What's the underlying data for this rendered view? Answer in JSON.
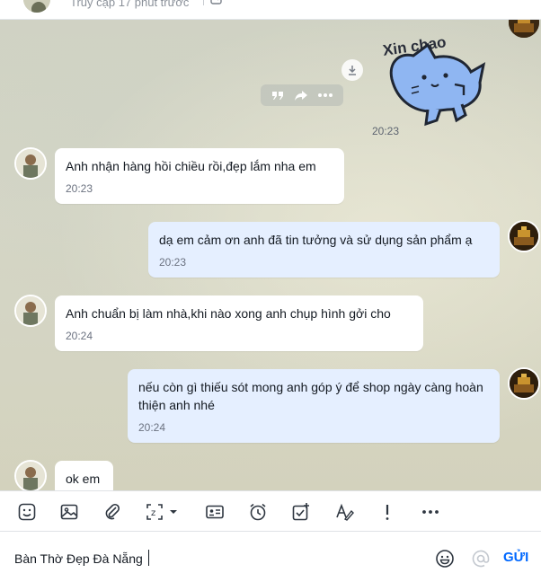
{
  "header": {
    "status_text": "Truy cập 17 phút trước"
  },
  "sticker": {
    "text": "Xin chao",
    "time": "20:23"
  },
  "messages": [
    {
      "direction": "in",
      "text": "Anh nhận hàng hồi chiều rồi,đẹp lắm nha em",
      "time": "20:23"
    },
    {
      "direction": "out",
      "text": "dạ em cảm ơn anh đã tin tưởng và sử dụng sản phẩm ạ",
      "time": "20:23"
    },
    {
      "direction": "in",
      "text": "Anh chuẩn bị làm nhà,khi nào xong anh chụp hình gởi cho",
      "time": "20:24"
    },
    {
      "direction": "out",
      "text": "nếu còn gì thiếu sót mong anh góp ý để shop ngày càng hoàn thiện anh nhé",
      "time": "20:24"
    },
    {
      "direction": "in",
      "text": "ok em",
      "time": ""
    }
  ],
  "toolbar": {
    "icons": [
      "sticker-icon",
      "image-icon",
      "attachment-icon",
      "screenshot-icon",
      "business-card-icon",
      "reminder-icon",
      "task-icon",
      "text-format-icon",
      "urgent-icon",
      "more-icon"
    ]
  },
  "composer": {
    "value": "Bàn Thờ Đẹp Đà Nẵng",
    "send_label": "GỬI"
  },
  "colors": {
    "accent": "#0068ff",
    "incoming_bubble": "#ffffff",
    "outgoing_bubble": "#e5efff"
  }
}
